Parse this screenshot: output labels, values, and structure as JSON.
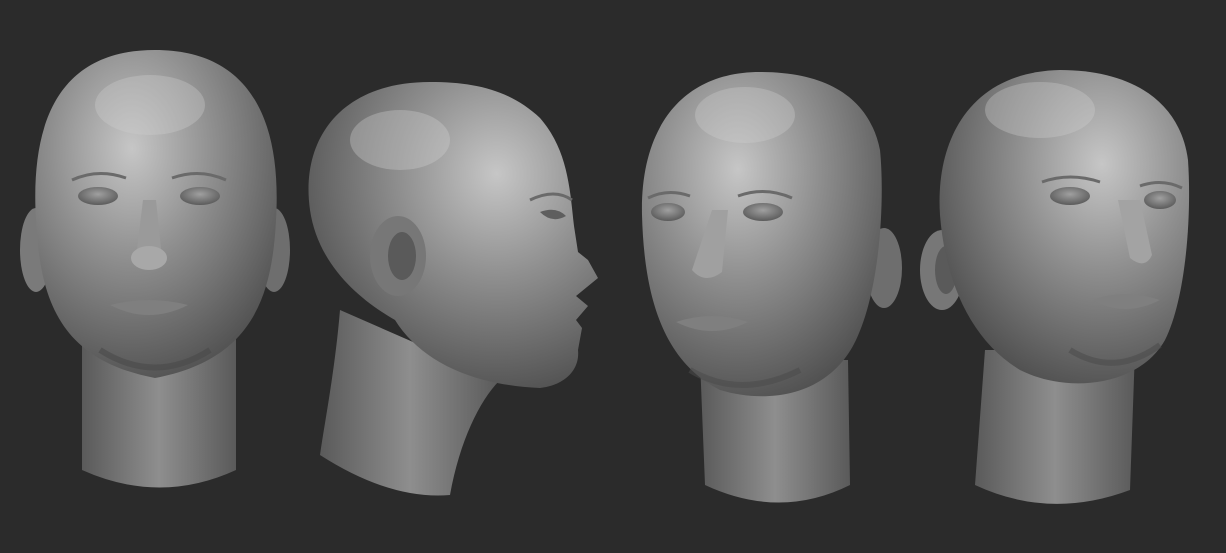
{
  "scene": {
    "background_color": "#2b2b2b",
    "material_base_color": "#8a8a8a",
    "material_highlight_color": "#c9c9c9",
    "material_shadow_color": "#4a4a4a",
    "heads": [
      {
        "view": "front"
      },
      {
        "view": "right-profile"
      },
      {
        "view": "three-quarter-left"
      },
      {
        "view": "three-quarter-right"
      }
    ]
  }
}
